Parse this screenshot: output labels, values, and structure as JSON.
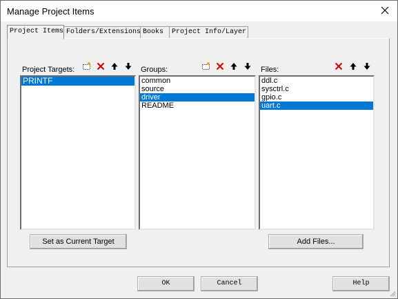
{
  "window": {
    "title": "Manage Project Items"
  },
  "tabs": [
    "Project Items",
    "Folders/Extensions",
    "Books",
    "Project Info/Layer"
  ],
  "targets": {
    "label": "Project Targets:",
    "items": [
      "PRINTF"
    ],
    "selected": 0
  },
  "groups": {
    "label": "Groups:",
    "items": [
      "common",
      "source",
      "driver",
      "README"
    ],
    "selected": 2
  },
  "files": {
    "label": "Files:",
    "items": [
      "ddl.c",
      "sysctrl.c",
      "gpio.c",
      "uart.c"
    ],
    "selected": 3
  },
  "buttons": {
    "set_current": "Set as Current Target",
    "add_files": "Add Files...",
    "ok": "OK",
    "cancel": "Cancel",
    "help": "Help"
  },
  "colors": {
    "selection": "#0078d7",
    "delete_red": "#d00000"
  },
  "icons": [
    "new-item-icon",
    "delete-icon",
    "move-up-icon",
    "move-down-icon",
    "close-icon"
  ]
}
